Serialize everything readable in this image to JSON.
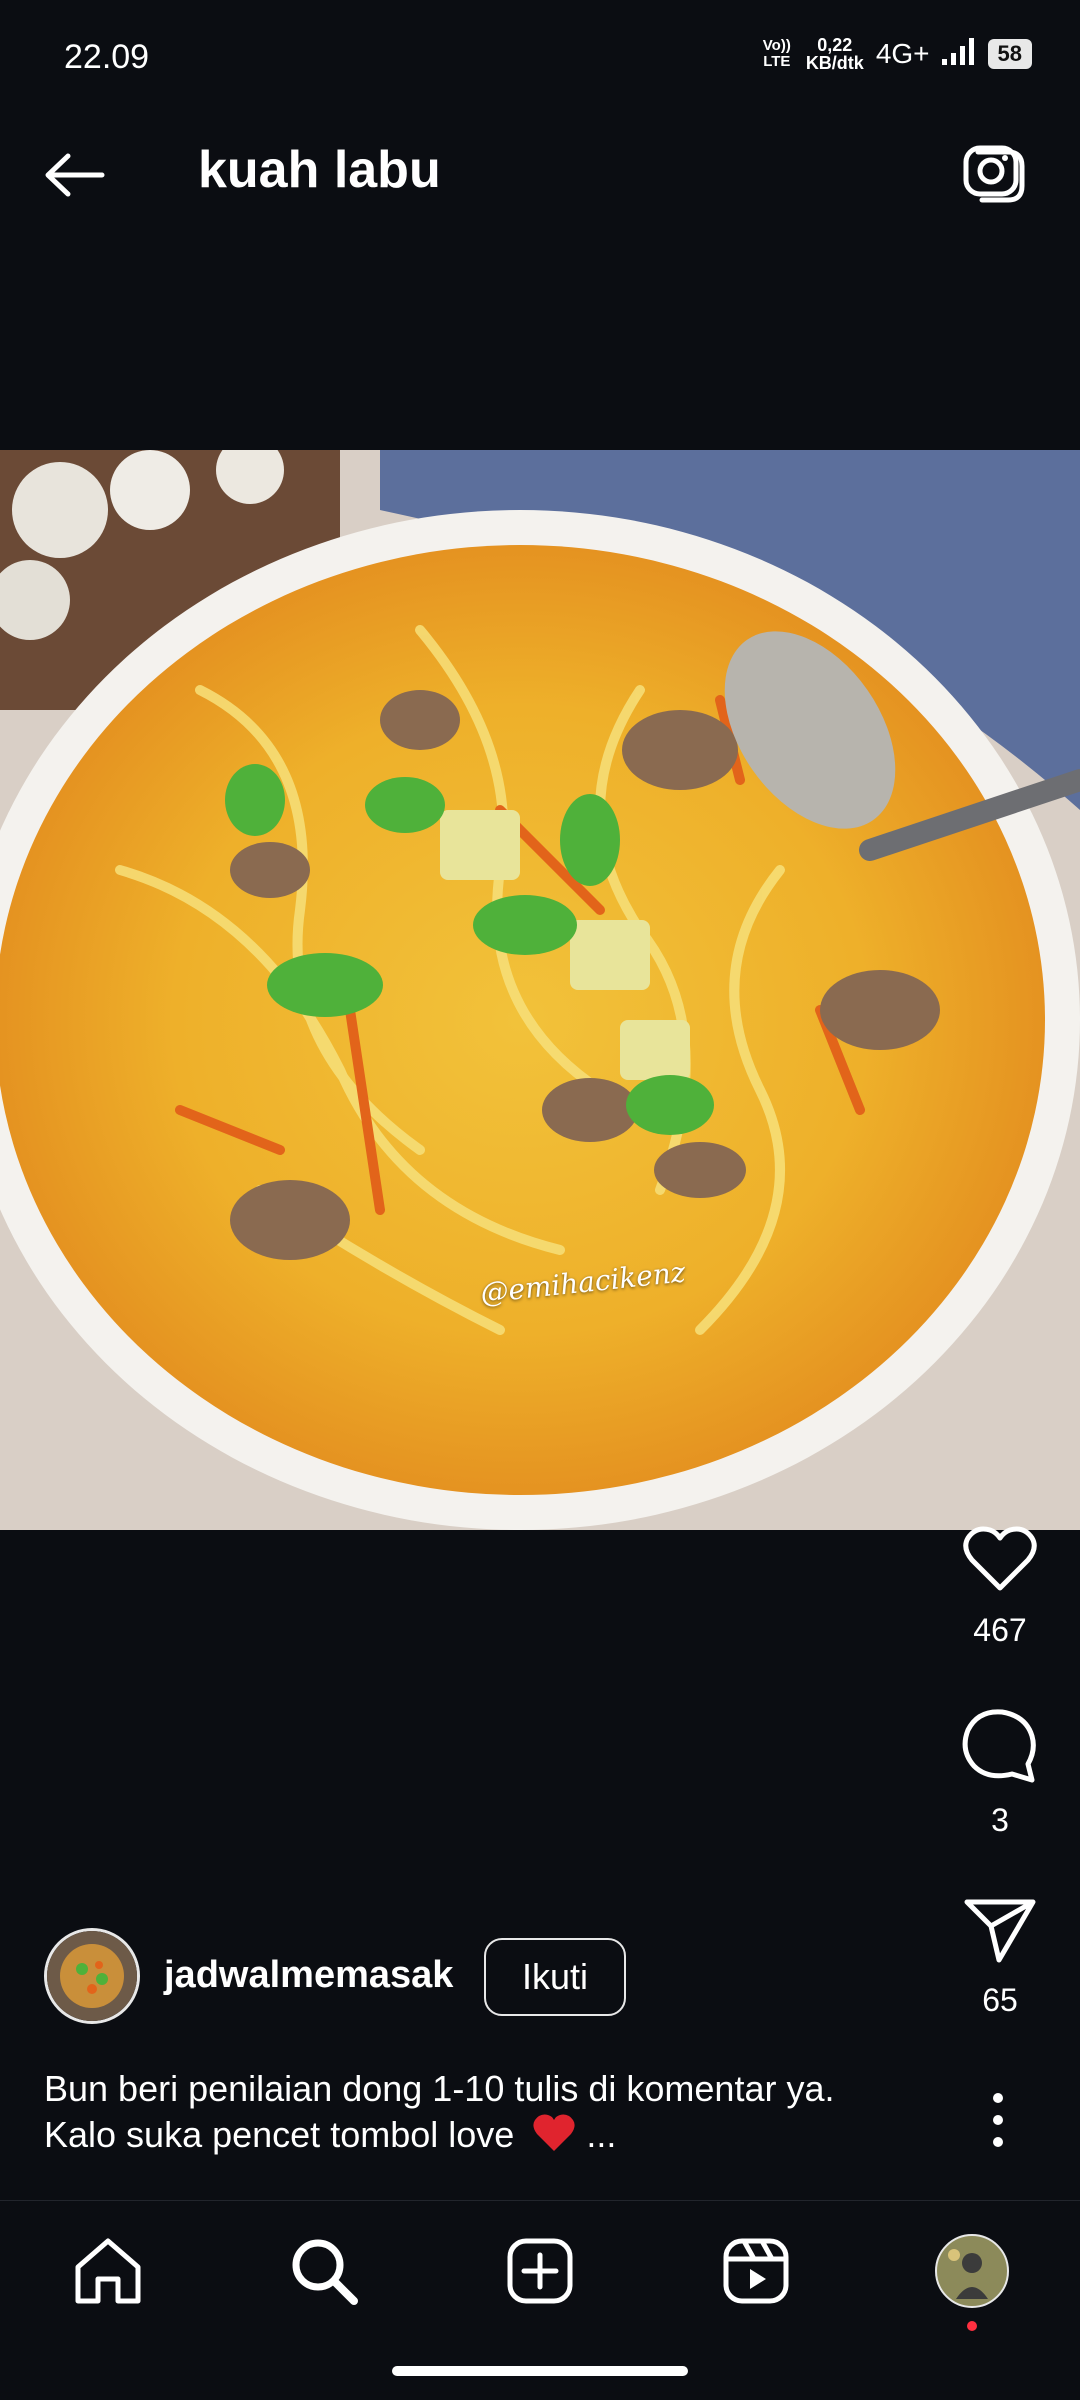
{
  "status_bar": {
    "time": "22.09",
    "volte": "Vo)) LTE",
    "speed_value": "0,22",
    "speed_unit": "KB/dtk",
    "network": "4G+",
    "battery": "58"
  },
  "header": {
    "title": "kuah labu"
  },
  "post": {
    "watermark": "@emihacikenz",
    "actions": {
      "likes": "467",
      "comments": "3",
      "shares": "65"
    },
    "author": {
      "username": "jadwalmemasak",
      "follow_label": "Ikuti"
    },
    "caption_line1": "Bun beri penilaian dong 1-10 tulis di komentar ya.",
    "caption_line2": "Kalo suka pencet tombol love",
    "caption_more": " ..."
  },
  "icons": {
    "back": "arrow-left-icon",
    "camera": "camera-icon",
    "like": "heart-icon",
    "comment": "comment-icon",
    "share": "send-icon",
    "more": "more-vertical-icon",
    "nav": [
      "home-icon",
      "search-icon",
      "create-icon",
      "reels-icon",
      "profile-avatar"
    ]
  },
  "colors": {
    "background": "#0b0d12",
    "text": "#ffffff",
    "heart_emoji": "#e0242e"
  }
}
